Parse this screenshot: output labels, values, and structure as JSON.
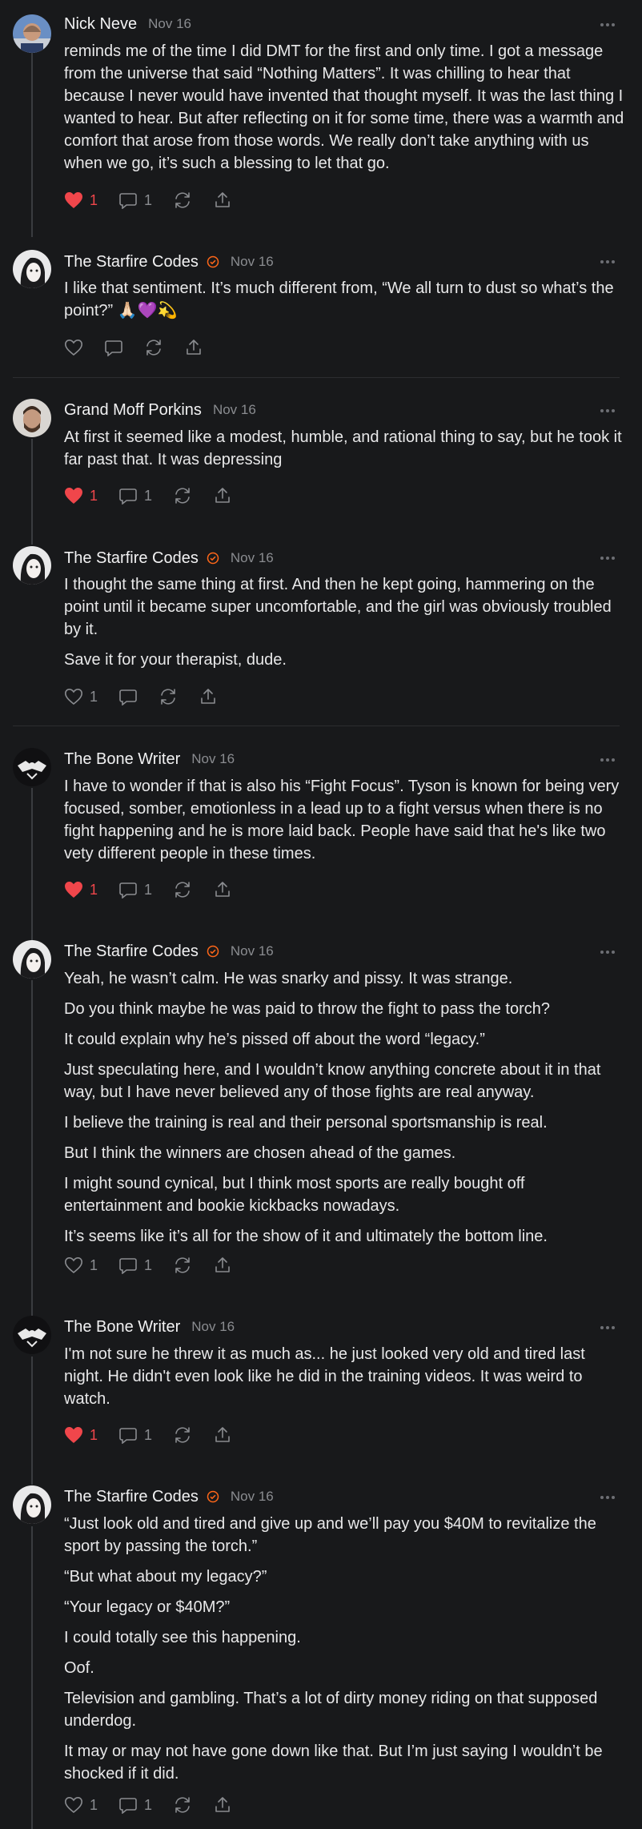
{
  "colors": {
    "background": "#18191b",
    "like_red": "#f0464b",
    "verified_orange": "#ff6719",
    "muted": "#8a8c90"
  },
  "posts": [
    {
      "author": "Nick Neve",
      "date": "Nov 16",
      "verified": false,
      "avatar": "avatar-nick",
      "paragraphs": [
        "reminds me of the time I did DMT for the first and only time. I got a message from the universe that said “Nothing Matters”. It was chilling to hear that because I never would have invented that thought myself. It was the last thing I wanted to hear. But after reflecting on it for some time, there was a warmth and comfort that arose from those words. We really don’t take anything with us when we go, it’s such a blessing to let that go."
      ],
      "likes": "1",
      "liked": true,
      "comments": "1"
    },
    {
      "author": "The Starfire Codes",
      "date": "Nov 16",
      "verified": true,
      "avatar": "avatar-starfire",
      "paragraphs": [
        "I like that sentiment. It’s much different from, “We all turn to dust so what’s the point?” 🙏🏻💜💫"
      ],
      "likes": "",
      "liked": false,
      "comments": ""
    },
    {
      "author": "Grand Moff Porkins",
      "date": "Nov 16",
      "verified": false,
      "avatar": "avatar-porkins",
      "paragraphs": [
        "At first it seemed like a modest, humble, and rational thing to say, but he took it far past that. It was depressing"
      ],
      "likes": "1",
      "liked": true,
      "comments": "1"
    },
    {
      "author": "The Starfire Codes",
      "date": "Nov 16",
      "verified": true,
      "avatar": "avatar-starfire",
      "paragraphs": [
        "I thought the same thing at first. And then he kept going, hammering on the point until it became super uncomfortable, and the girl was obviously troubled by it.",
        "Save it for your therapist, dude."
      ],
      "likes": "1",
      "liked": false,
      "comments": ""
    },
    {
      "author": "The Bone Writer",
      "date": "Nov 16",
      "verified": false,
      "avatar": "avatar-bone",
      "paragraphs": [
        "I have to wonder if that is also his “Fight Focus”. Tyson is known for being very focused, somber, emotionless in a lead up to a fight versus when there is no fight happening and he is more laid back. People have said that he's like two vety different people in these times."
      ],
      "likes": "1",
      "liked": true,
      "comments": "1"
    },
    {
      "author": "The Starfire Codes",
      "date": "Nov 16",
      "verified": true,
      "avatar": "avatar-starfire",
      "paragraphs": [
        "Yeah, he wasn’t calm. He was snarky and pissy. It was strange.",
        "Do you think maybe he was paid to throw the fight to pass the torch?",
        "It could explain why he’s pissed off about the word “legacy.”",
        "Just speculating here, and I wouldn’t know anything concrete about it in that way, but I have never believed any of those fights are real anyway.",
        "I believe the training is real and their personal sportsmanship is real.",
        "But I think the winners are chosen ahead of the games.",
        "I might sound cynical, but I think most sports are really bought off entertainment and bookie kickbacks nowadays.",
        "It’s seems like it’s all for the show of it and ultimately the bottom line."
      ],
      "likes": "1",
      "liked": false,
      "comments": "1"
    },
    {
      "author": "The Bone Writer",
      "date": "Nov 16",
      "verified": false,
      "avatar": "avatar-bone",
      "paragraphs": [
        "I'm not sure he threw it as much as... he just looked very old and tired last night. He didn't even look like he did in the training videos. It was weird to watch."
      ],
      "likes": "1",
      "liked": true,
      "comments": "1"
    },
    {
      "author": "The Starfire Codes",
      "date": "Nov 16",
      "verified": true,
      "avatar": "avatar-starfire",
      "paragraphs": [
        "“Just look old and tired and give up and we’ll pay you $40M to revitalize the sport by passing the torch.”",
        "“But what about my legacy?”",
        "“Your legacy or $40M?”",
        "I could totally see this happening.",
        "Oof.",
        "Television and gambling. That’s a lot of dirty money riding on that supposed underdog.",
        "It may or may not have gone down like that. But I’m just saying I wouldn’t be shocked if it did."
      ],
      "likes": "1",
      "liked": false,
      "comments": "1"
    }
  ]
}
